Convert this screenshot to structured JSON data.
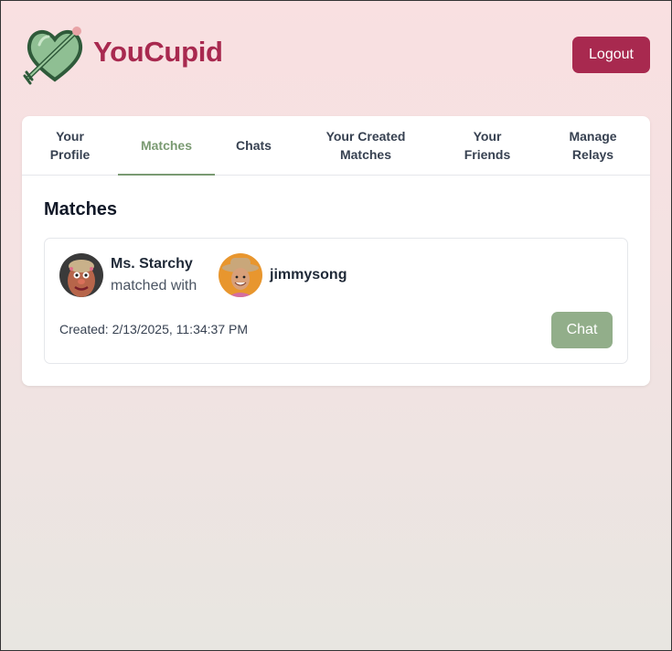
{
  "app": {
    "brand": "YouCupid",
    "logout_label": "Logout",
    "colors": {
      "brand": "#a8294f",
      "accent": "#7a9a72",
      "chat_button": "#92ae8a"
    }
  },
  "tabs": [
    {
      "label": "Your Profile",
      "active": false
    },
    {
      "label": "Matches",
      "active": true
    },
    {
      "label": "Chats",
      "active": false
    },
    {
      "label": "Your Created Matches",
      "active": false
    },
    {
      "label": "Your Friends",
      "active": false
    },
    {
      "label": "Manage Relays",
      "active": false
    }
  ],
  "matches": {
    "title": "Matches",
    "items": [
      {
        "user1": "Ms. Starchy",
        "connector": "matched with",
        "user2": "jimmysong",
        "created": "Created: 2/13/2025, 11:34:37 PM",
        "chat_label": "Chat"
      }
    ]
  },
  "icons": {
    "logo": "heart-arrow-icon",
    "avatar1": "potato-avatar",
    "avatar2": "cowboy-avatar"
  }
}
